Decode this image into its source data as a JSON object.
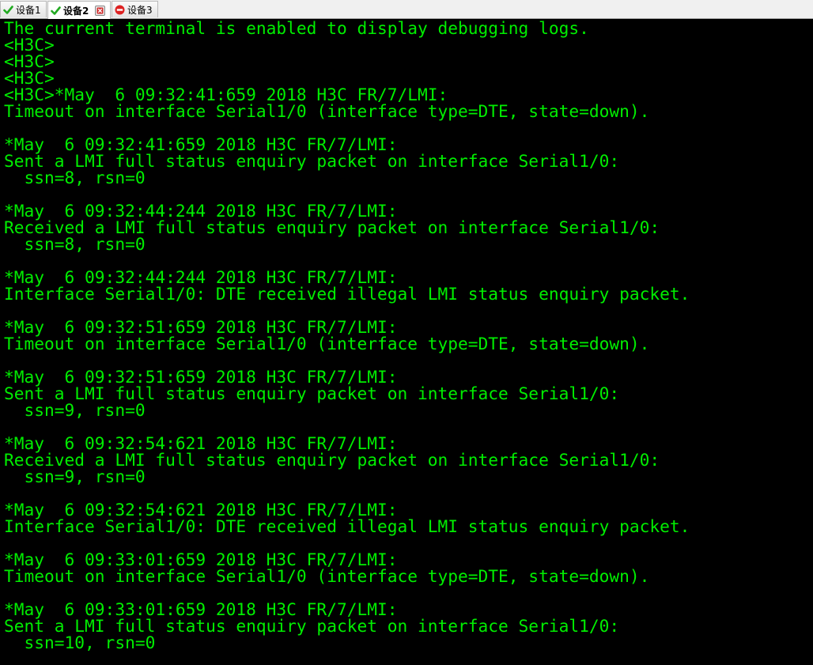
{
  "tabs": [
    {
      "label": "设备1",
      "status_icon": "check-icon",
      "status_color": "#22aa22",
      "active": false
    },
    {
      "label": "设备2",
      "status_icon": "check-icon",
      "status_color": "#22aa22",
      "active": true,
      "closable": true
    },
    {
      "label": "设备3",
      "status_icon": "stop-icon",
      "status_color": "#dd2222",
      "active": false
    }
  ],
  "terminal": {
    "text_color": "#00ee00",
    "background_color": "#000000",
    "lines": [
      "The current terminal is enabled to display debugging logs.",
      "<H3C>",
      "<H3C>",
      "<H3C>",
      "<H3C>*May  6 09:32:41:659 2018 H3C FR/7/LMI:",
      "Timeout on interface Serial1/0 (interface type=DTE, state=down).",
      "",
      "*May  6 09:32:41:659 2018 H3C FR/7/LMI:",
      "Sent a LMI full status enquiry packet on interface Serial1/0:",
      "  ssn=8, rsn=0",
      "",
      "*May  6 09:32:44:244 2018 H3C FR/7/LMI:",
      "Received a LMI full status enquiry packet on interface Serial1/0:",
      "  ssn=8, rsn=0",
      "",
      "*May  6 09:32:44:244 2018 H3C FR/7/LMI:",
      "Interface Serial1/0: DTE received illegal LMI status enquiry packet.",
      "",
      "*May  6 09:32:51:659 2018 H3C FR/7/LMI:",
      "Timeout on interface Serial1/0 (interface type=DTE, state=down).",
      "",
      "*May  6 09:32:51:659 2018 H3C FR/7/LMI:",
      "Sent a LMI full status enquiry packet on interface Serial1/0:",
      "  ssn=9, rsn=0",
      "",
      "*May  6 09:32:54:621 2018 H3C FR/7/LMI:",
      "Received a LMI full status enquiry packet on interface Serial1/0:",
      "  ssn=9, rsn=0",
      "",
      "*May  6 09:32:54:621 2018 H3C FR/7/LMI:",
      "Interface Serial1/0: DTE received illegal LMI status enquiry packet.",
      "",
      "*May  6 09:33:01:659 2018 H3C FR/7/LMI:",
      "Timeout on interface Serial1/0 (interface type=DTE, state=down).",
      "",
      "*May  6 09:33:01:659 2018 H3C FR/7/LMI:",
      "Sent a LMI full status enquiry packet on interface Serial1/0:",
      "  ssn=10, rsn=0"
    ]
  }
}
